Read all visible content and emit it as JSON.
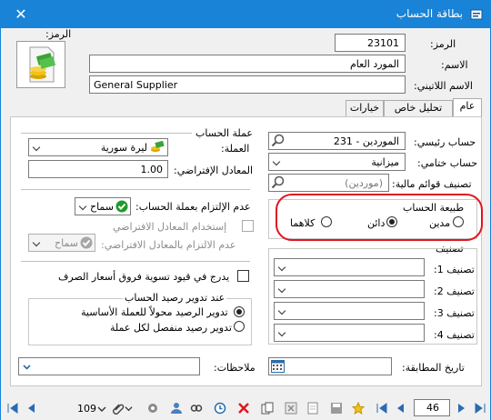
{
  "window": {
    "title": "بطاقة الحساب",
    "close_glyph": "✕"
  },
  "header": {
    "code_label": "الرمز:",
    "code_value": "23101",
    "name_label": "الاسم:",
    "name_value": "المورد العام",
    "latin_name_label": "الاسم اللاتيني:",
    "latin_name_value": "General Supplier",
    "image_label": "الرمز:"
  },
  "tabs": [
    {
      "label": "عام"
    },
    {
      "label": "تحليل خاص"
    },
    {
      "label": "خيارات"
    }
  ],
  "right": {
    "main_account_label": "حساب رئيسي:",
    "main_account_value": "231 - الموردين",
    "final_account_label": "حساب ختامي:",
    "final_account_value": "ميزانية",
    "fin_class_label": "تصنيف قوائم مالية:",
    "fin_class_value": "(موردين)",
    "nature_title": "طبيعة الحساب",
    "nature_options": [
      "مدين",
      "دائن",
      "كلاهما"
    ],
    "nature_selected": 1,
    "class_title": "تصنيف",
    "class_labels": [
      "تصنيف 1:",
      "تصنيف 2:",
      "تصنيف 3:",
      "تصنيف 4:"
    ],
    "match_date_label": "تاريخ المطابقة:"
  },
  "left": {
    "currency_section": "عملة الحساب",
    "currency_label": "العملة:",
    "currency_value": "ليرة سورية",
    "default_rate_label": "المعادل الإفتراضي:",
    "default_rate_value": "1.00",
    "non_commit_label": "عدم الإلتزام بعملة الحساب:",
    "non_commit_value": "سماح",
    "use_default_rate_label": "إستخدام المعادل الافتراضي",
    "non_commit_default_label": "عدم الالتزام بالمعادل الافتراضي:",
    "non_commit_default_value": "سماح",
    "diff_check_label": "يدرج في قيود تسوية فروق أسعار الصرف",
    "rounding_title": "عند تدوير رصيد الحساب",
    "rounding_options": [
      "تدوير الرصيد محولاً للعملة الأساسية",
      "تدوير رصيد منفصل لكل عملة"
    ],
    "rounding_selected": 0,
    "notes_label": "ملاحظات:"
  },
  "statusbar": {
    "record_count": "109",
    "page_number": "46"
  },
  "colors": {
    "title_bar": "#1883d7",
    "highlight": "#e0141e",
    "ok_green": "#1e9b2a"
  }
}
